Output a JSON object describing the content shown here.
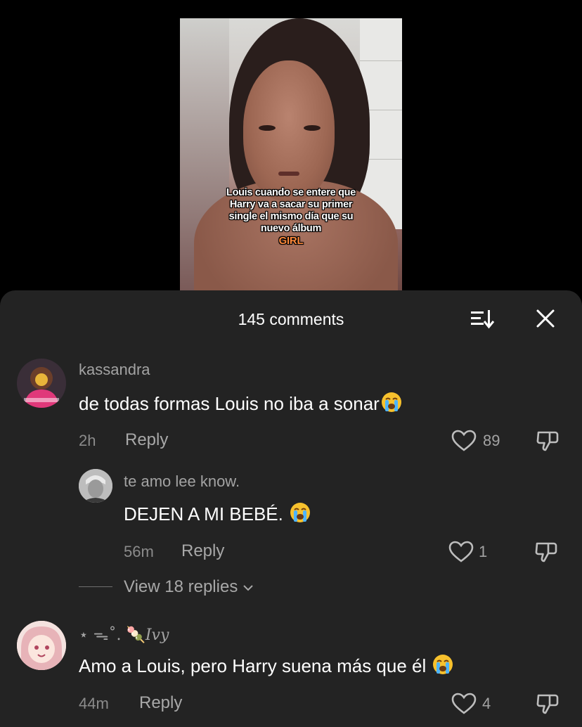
{
  "video": {
    "caption_lines": [
      "Louis cuando se entere que",
      "Harry va a sacar su primer",
      "single el mismo día que su",
      "nuevo álbum"
    ],
    "caption_highlight": "GIRL",
    "highlight_color": "#ff8a3c"
  },
  "panel": {
    "title": "145 comments",
    "sort_icon": "sort-descending-icon",
    "close_icon": "close-icon"
  },
  "comments": [
    {
      "username": "kassandra",
      "text": "de todas formas Louis no iba a sonar",
      "emoji": "loudly-crying-face",
      "time": "2h",
      "reply_label": "Reply",
      "likes": "89"
    },
    {
      "username": "te amo lee know.",
      "text": "DEJEN A MI BEBÉ. ",
      "emoji": "loudly-crying-face",
      "time": "56m",
      "reply_label": "Reply",
      "likes": "1"
    },
    {
      "username": "⋆ ᯓ˚.  🍡𝐼𝑣𝑦",
      "text": "Amo a Louis, pero Harry suena más que él ",
      "emoji": "loudly-crying-face",
      "time": "44m",
      "reply_label": "Reply",
      "likes": "4"
    }
  ],
  "view_replies": "View 18 replies",
  "colors": {
    "panel_bg": "#232323",
    "text_primary": "#ffffff",
    "text_secondary": "#a3a3a3"
  }
}
